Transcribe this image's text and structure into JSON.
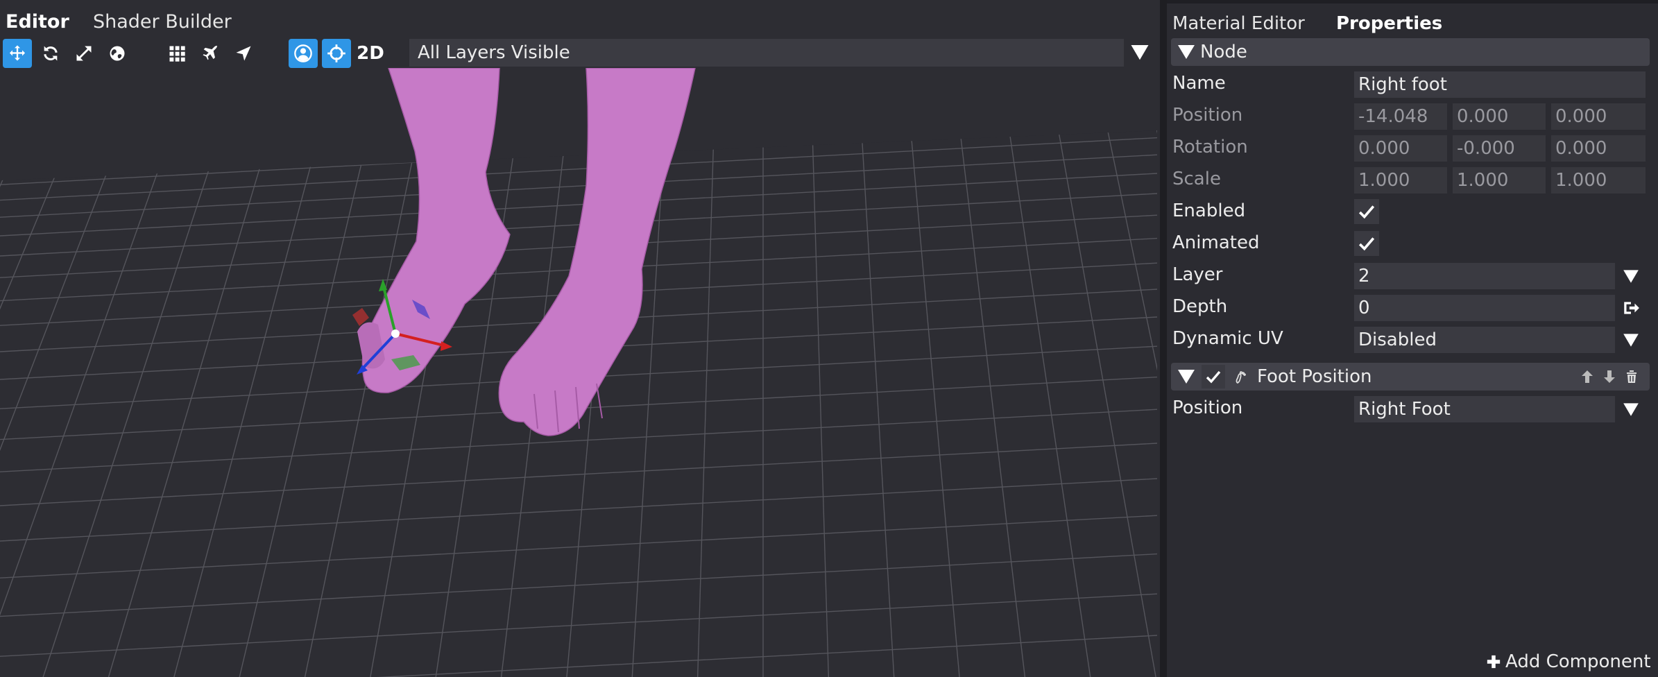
{
  "tabs": {
    "editor": "Editor",
    "shader_builder": "Shader Builder"
  },
  "toolbar": {
    "icons": [
      "move-icon",
      "rotate-icon",
      "scale-icon",
      "globe-icon",
      "grid-icon",
      "plane-icon",
      "navigate-icon",
      "avatar-icon",
      "pivot-icon"
    ],
    "mode_2d": "2D",
    "layers_value": "All Layers Visible"
  },
  "right_tabs": {
    "material_editor": "Material Editor",
    "properties": "Properties"
  },
  "node": {
    "header": "Node",
    "name_label": "Name",
    "name_value": "Right foot",
    "position_label": "Position",
    "position": [
      "-14.048",
      "0.000",
      "0.000"
    ],
    "rotation_label": "Rotation",
    "rotation": [
      "0.000",
      "-0.000",
      "0.000"
    ],
    "scale_label": "Scale",
    "scale": [
      "1.000",
      "1.000",
      "1.000"
    ],
    "enabled_label": "Enabled",
    "enabled": true,
    "animated_label": "Animated",
    "animated": true,
    "layer_label": "Layer",
    "layer_value": "2",
    "depth_label": "Depth",
    "depth_value": "0",
    "dynamic_uv_label": "Dynamic UV",
    "dynamic_uv_value": "Disabled"
  },
  "component": {
    "header": "Foot Position",
    "position_label": "Position",
    "position_value": "Right Foot"
  },
  "add_component": "Add Component",
  "colors": {
    "accent": "#2f96e6",
    "model": "#c77ac7",
    "axis_x": "#d42020",
    "axis_y": "#2aa12a",
    "axis_z": "#1f3fd8"
  }
}
